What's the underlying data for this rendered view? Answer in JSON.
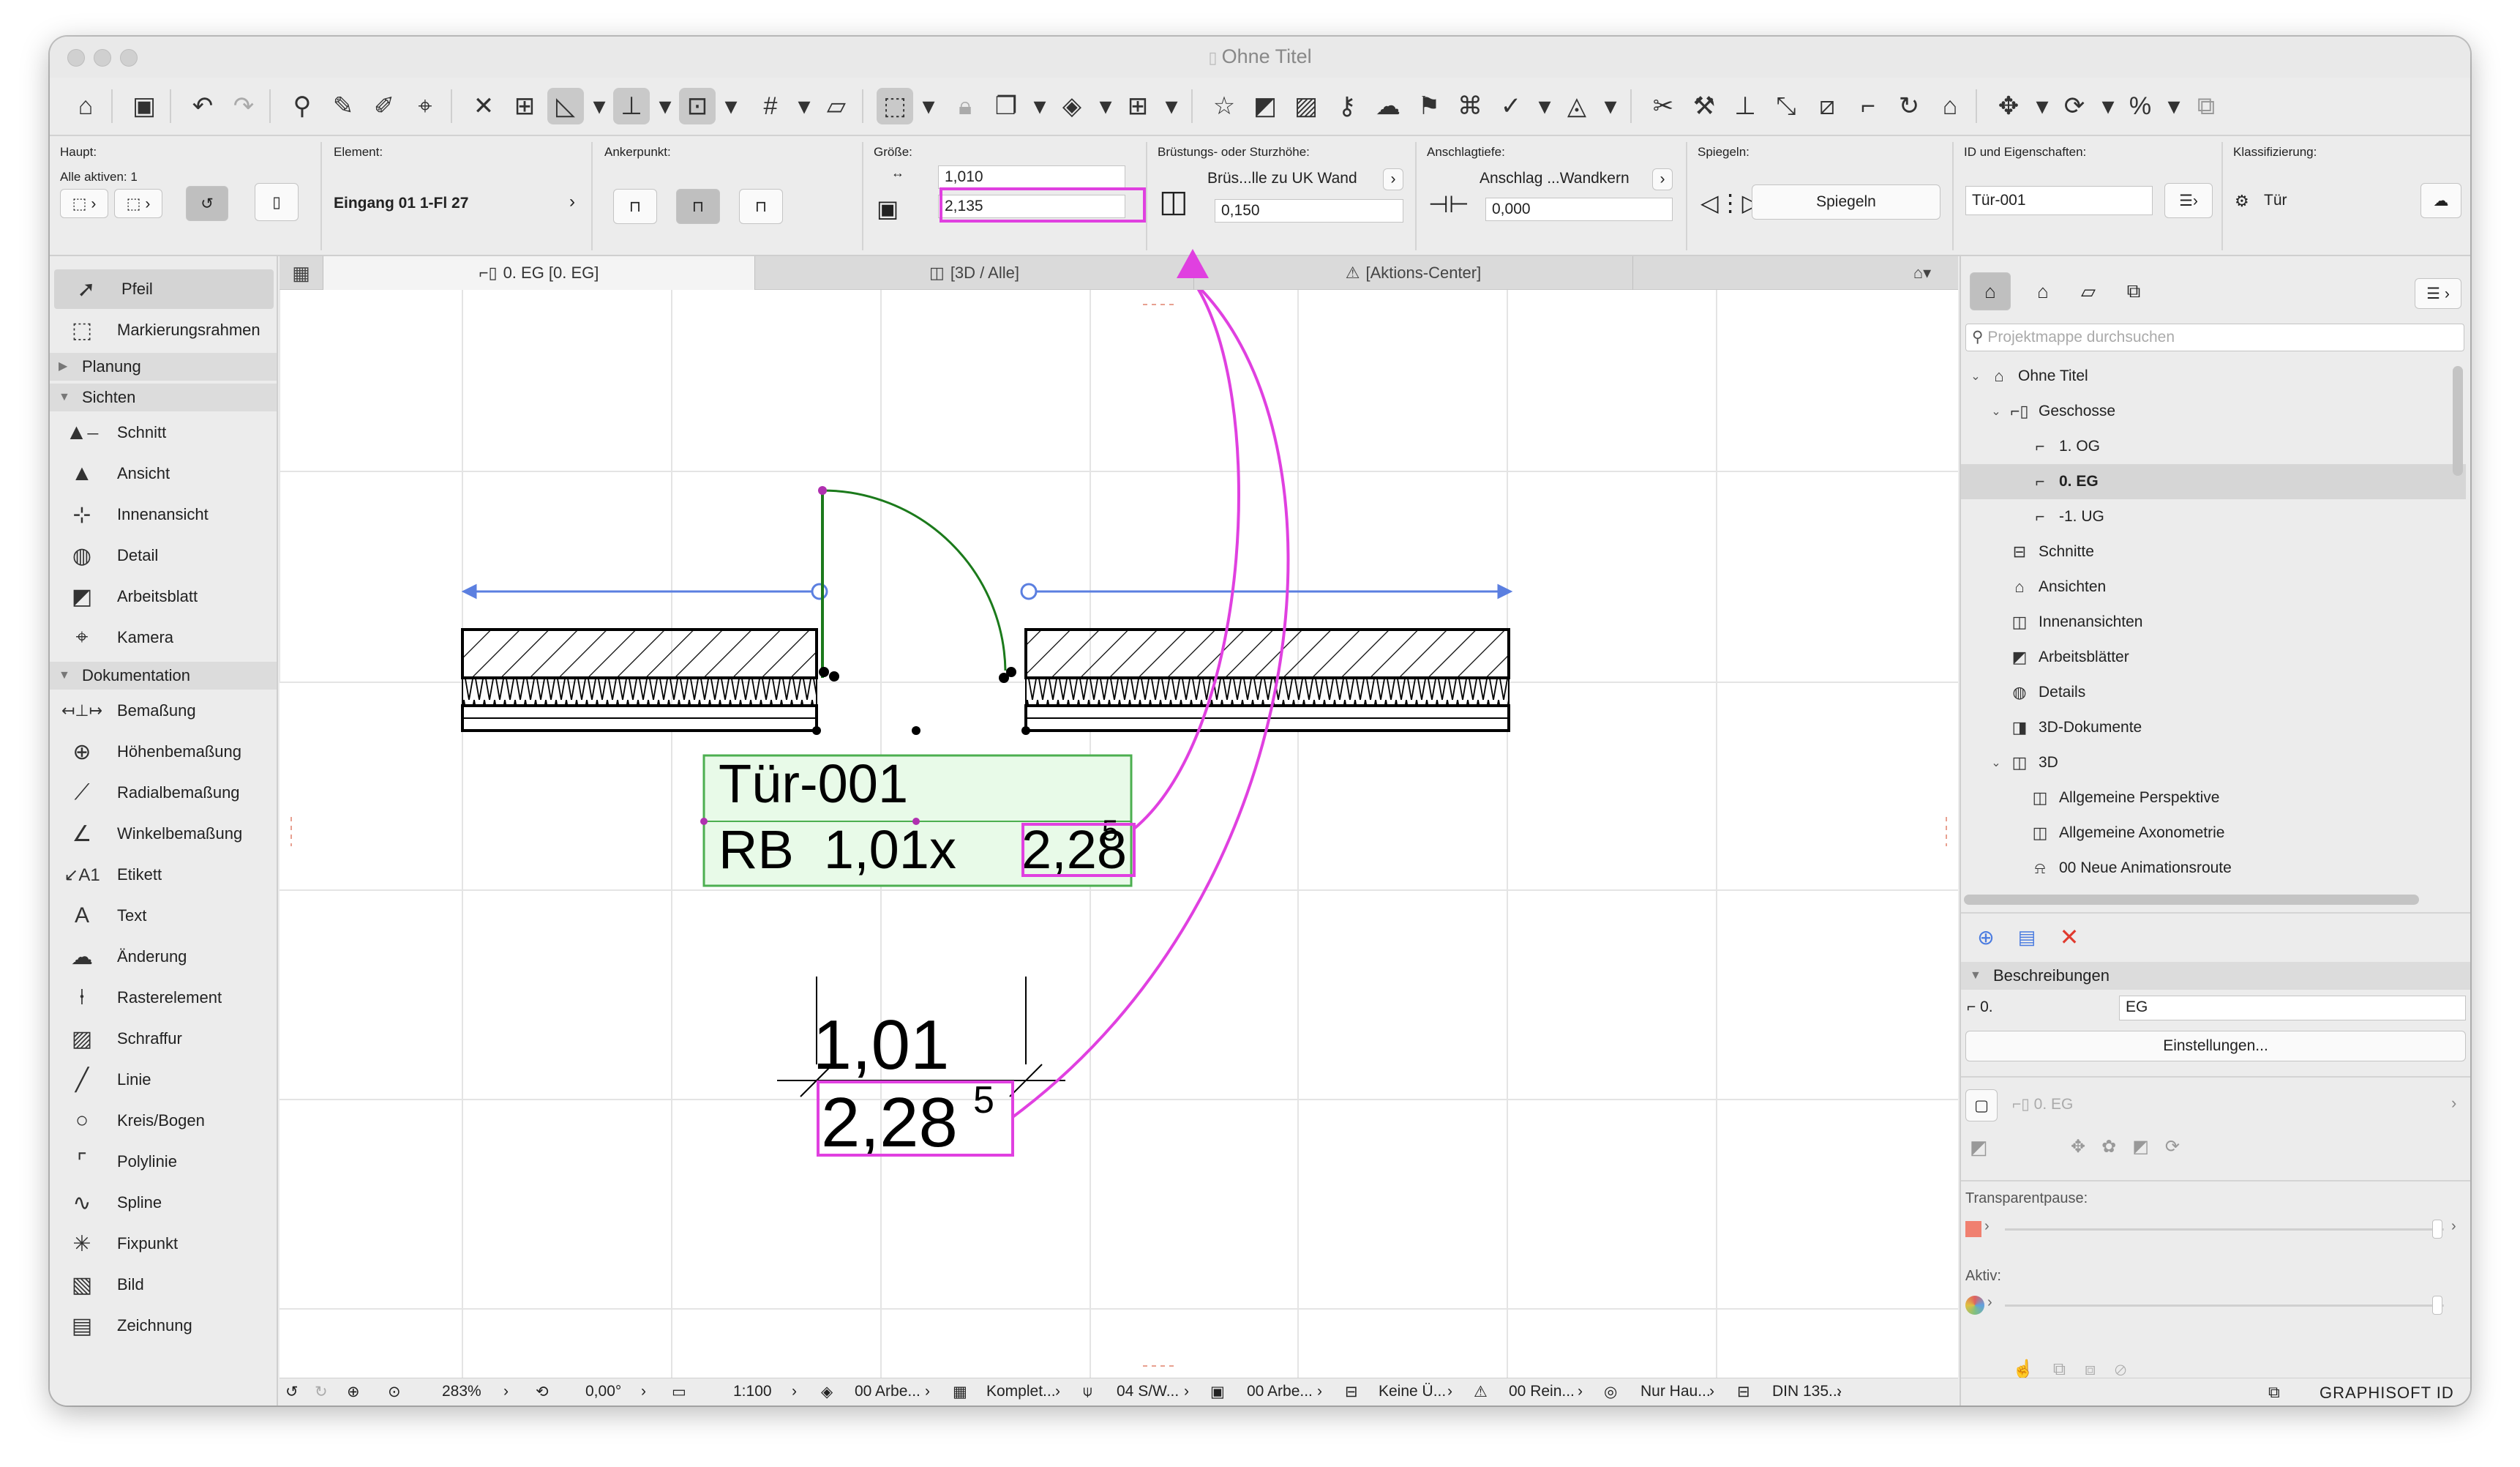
{
  "window": {
    "title": "Ohne Titel"
  },
  "infobox": {
    "haupt": {
      "label": "Haupt:",
      "sub": "Alle aktiven: 1"
    },
    "element": {
      "label": "Element:",
      "value": "Eingang 01 1-Fl 27"
    },
    "anker": {
      "label": "Ankerpunkt:"
    },
    "groesse": {
      "label": "Größe:",
      "width": "1,010",
      "height": "2,135"
    },
    "bruestung": {
      "label": "Brüstungs- oder Sturzhöhe:",
      "mode": "Brüs...lle zu UK Wand",
      "value": "0,150"
    },
    "anschlag": {
      "label": "Anschlagtiefe:",
      "mode": "Anschlag ...Wandkern",
      "value": "0,000"
    },
    "spiegeln": {
      "label": "Spiegeln:",
      "button": "Spiegeln"
    },
    "id": {
      "label": "ID und Eigenschaften:",
      "value": "Tür-001"
    },
    "klass": {
      "label": "Klassifizierung:",
      "value": "Tür"
    }
  },
  "toolbox": {
    "top": [
      {
        "icon": "arrow-icon",
        "label": "Pfeil"
      },
      {
        "icon": "marquee-icon",
        "label": "Markierungsrahmen"
      }
    ],
    "groups": {
      "planung": "Planung",
      "sichten": "Sichten",
      "dokumentation": "Dokumentation"
    },
    "sichten": [
      "Schnitt",
      "Ansicht",
      "Innenansicht",
      "Detail",
      "Arbeitsblatt",
      "Kamera"
    ],
    "dokumentation": [
      "Bemaßung",
      "Höhenbemaßung",
      "Radialbemaßung",
      "Winkelbemaßung",
      "Etikett",
      "Text",
      "Änderung",
      "Rasterelement",
      "Schraffur",
      "Linie",
      "Kreis/Bogen",
      "Polylinie",
      "Spline",
      "Fixpunkt",
      "Bild",
      "Zeichnung"
    ]
  },
  "tabs": [
    "0. EG [0. EG]",
    "[3D / Alle]",
    "[Aktions-Center]"
  ],
  "drawing": {
    "label_title": "Tür-001",
    "label_prefix": "RB  1,01x",
    "label_height": "2,28",
    "label_sup": "5",
    "dim_width": "1,01",
    "dim_height": "2,28",
    "dim_sup": "5"
  },
  "status": {
    "zoom": "283%",
    "angle": "0,00°",
    "scale": "1:100",
    "layer": "00 Arbe...",
    "struct": "Komplet...",
    "pen": "04 S/W...",
    "layout": "00 Arbe...",
    "override": "Keine Ü...",
    "renov": "00 Rein...",
    "model": "Nur Hau...",
    "dim": "DIN 135..."
  },
  "navigator": {
    "search_placeholder": "Projektmappe durchsuchen",
    "tree": [
      {
        "label": "Ohne Titel",
        "level": 0,
        "arrow": "v",
        "icon": "house-icon"
      },
      {
        "label": "Geschosse",
        "level": 1,
        "arrow": "v",
        "icon": "stories-icon"
      },
      {
        "label": "1. OG",
        "level": 2,
        "icon": "story-icon"
      },
      {
        "label": "0. EG",
        "level": 2,
        "icon": "story-icon",
        "selected": true
      },
      {
        "label": "-1. UG",
        "level": 2,
        "icon": "story-icon"
      },
      {
        "label": "Schnitte",
        "level": 1,
        "icon": "section-icon"
      },
      {
        "label": "Ansichten",
        "level": 1,
        "icon": "elevation-icon"
      },
      {
        "label": "Innenansichten",
        "level": 1,
        "icon": "interior-icon"
      },
      {
        "label": "Arbeitsblätter",
        "level": 1,
        "icon": "worksheet-icon"
      },
      {
        "label": "Details",
        "level": 1,
        "icon": "detail-icon"
      },
      {
        "label": "3D-Dokumente",
        "level": 1,
        "icon": "3d-doc-icon"
      },
      {
        "label": "3D",
        "level": 1,
        "arrow": "v",
        "icon": "3d-icon"
      },
      {
        "label": "Allgemeine Perspektive",
        "level": 2,
        "icon": "perspective-icon"
      },
      {
        "label": "Allgemeine Axonometrie",
        "level": 2,
        "icon": "axonometry-icon"
      },
      {
        "label": "00 Neue Animationsroute",
        "level": 2,
        "icon": "camera-path-icon"
      }
    ],
    "props_header": "Beschreibungen",
    "props_id": "0.",
    "props_name": "EG",
    "settings_button": "Einstellungen...",
    "story_ref": "0. EG",
    "transparency_label": "Transparentpause:",
    "active_label": "Aktiv:",
    "footer": "GRAPHISOFT ID"
  },
  "colors": {
    "accent": "#e040e0",
    "label_bg": "#e8fae8",
    "label_border": "#4caf50",
    "door_green": "#1b7a1b",
    "dim_blue": "#5b7fe0"
  }
}
